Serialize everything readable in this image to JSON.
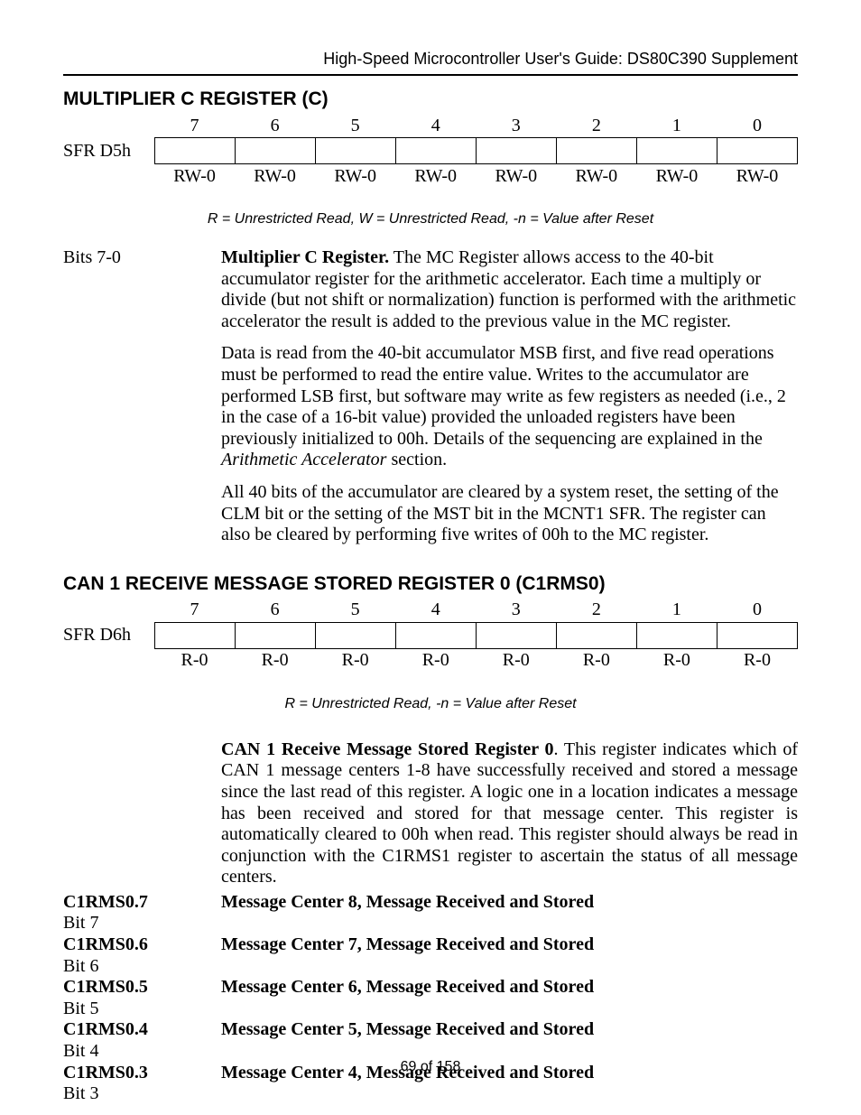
{
  "header": {
    "running": "High-Speed Microcontroller User's Guide: DS80C390 Supplement"
  },
  "reg1": {
    "title": "MULTIPLIER C REGISTER (C)",
    "bits": [
      "7",
      "6",
      "5",
      "4",
      "3",
      "2",
      "1",
      "0"
    ],
    "sfr": "SFR D5h",
    "cells": [
      "",
      "",
      "",
      "",
      "",
      "",
      "",
      ""
    ],
    "access": [
      "RW-0",
      "RW-0",
      "RW-0",
      "RW-0",
      "RW-0",
      "RW-0",
      "RW-0",
      "RW-0"
    ],
    "legend": "R = Unrestricted Read, W = Unrestricted Read, -n = Value after Reset",
    "desc_label": "Bits 7-0",
    "desc_bold": "Multiplier C Register.",
    "desc_p1": " The MC Register allows access to the 40-bit accumulator register for the arithmetic accelerator. Each time a multiply or divide (but not shift or normalization) function is performed with the arithmetic accelerator the result is added to the previous value in the MC register.",
    "desc_p2a": "Data is read from the 40-bit accumulator MSB first, and five read operations must be performed to read the entire value. Writes to the accumulator are performed LSB first, but software may write as few registers as needed (i.e., 2 in the case of a 16-bit value) provided the unloaded registers have been previously initialized to 00h. Details of the sequencing are explained in the ",
    "desc_p2_ital": "Arithmetic Accelerator",
    "desc_p2b": " section.",
    "desc_p3": "All 40 bits of the accumulator are cleared by a system reset, the setting of the CLM bit or the setting of the MST bit in the MCNT1 SFR. The register can also be cleared by performing five writes of 00h to the MC register."
  },
  "reg2": {
    "title": "CAN 1 RECEIVE MESSAGE STORED REGISTER 0 (C1RMS0)",
    "bits": [
      "7",
      "6",
      "5",
      "4",
      "3",
      "2",
      "1",
      "0"
    ],
    "sfr": "SFR D6h",
    "cells": [
      "",
      "",
      "",
      "",
      "",
      "",
      "",
      ""
    ],
    "access": [
      "R-0",
      "R-0",
      "R-0",
      "R-0",
      "R-0",
      "R-0",
      "R-0",
      "R-0"
    ],
    "legend": "R = Unrestricted Read, -n = Value after Reset",
    "desc_bold": "CAN 1 Receive Message Stored Register 0",
    "desc_p1": ". This register indicates which of CAN 1 message centers 1-8 have successfully received and stored a message since the last read of this register. A logic one in a location indicates a message has been received and stored for that message center. This register is automatically cleared to 00h when read. This register should always be read in conjunction with the C1RMS1 register to ascertain the status of all message centers.",
    "rows": [
      {
        "name": "C1RMS0.7",
        "bit": "Bit 7",
        "msg": "Message Center 8, Message Received and Stored"
      },
      {
        "name": "C1RMS0.6",
        "bit": "Bit 6",
        "msg": "Message Center 7, Message Received and Stored"
      },
      {
        "name": "C1RMS0.5",
        "bit": "Bit 5",
        "msg": "Message Center 6, Message Received and Stored"
      },
      {
        "name": "C1RMS0.4",
        "bit": "Bit 4",
        "msg": "Message Center 5, Message Received and Stored"
      },
      {
        "name": "C1RMS0.3",
        "bit": "Bit 3",
        "msg": "Message Center 4, Message Received and Stored"
      }
    ]
  },
  "footer": {
    "pagenum": "69 of 158"
  }
}
